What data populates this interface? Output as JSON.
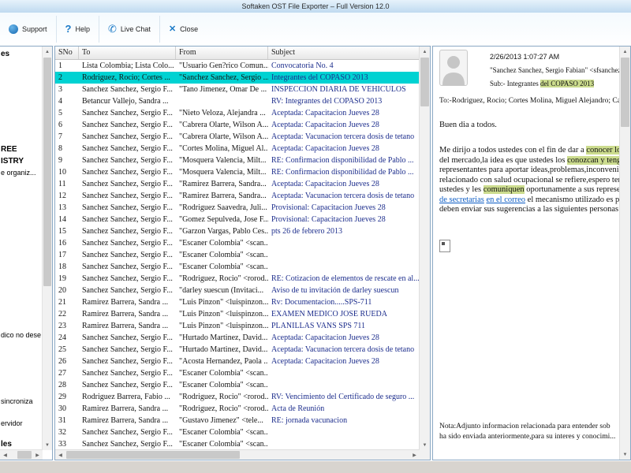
{
  "window": {
    "title": "Softaken OST File Exporter – Full Version 12.0"
  },
  "toolbar": {
    "buttons": [
      {
        "label": "Support",
        "icon": "support-icon"
      },
      {
        "label": "Help",
        "icon": "help-icon"
      },
      {
        "label": "Live Chat",
        "icon": "phone-icon"
      },
      {
        "label": "Close",
        "icon": "close-icon"
      }
    ]
  },
  "folder_tree": {
    "items": [
      {
        "label": "es",
        "bold": true
      },
      {
        "label": "REE",
        "bold": true
      },
      {
        "label": "ISTRY",
        "bold": true
      },
      {
        "label": "e organiz...",
        "bold": false
      },
      {
        "label": "dico no dese",
        "bold": false
      },
      {
        "label": "sincroniza",
        "bold": false
      },
      {
        "label": "ervidor",
        "bold": false
      },
      {
        "label": "les",
        "bold": true
      }
    ]
  },
  "mail_table": {
    "columns": [
      "SNo",
      "To",
      "From",
      "Subject"
    ],
    "selected_row": 2,
    "rows": [
      {
        "sno": 1,
        "to": "Lista Colombia; Lista Colo...",
        "from": "\"Usuario Gen?rico Comun...",
        "subject": "Convocatoria No. 4"
      },
      {
        "sno": 2,
        "to": "Rodriguez, Rocio; Cortes ...",
        "from": "\"Sanchez Sanchez, Sergio ...",
        "subject": "Integrantes del COPASO 2013"
      },
      {
        "sno": 3,
        "to": "Sanchez Sanchez, Sergio F...",
        "from": "\"Tano Jimenez, Omar De ...",
        "subject": "INSPECCION DIARIA DE VEHICULOS"
      },
      {
        "sno": 4,
        "to": "Betancur Vallejo, Sandra ...",
        "from": "",
        "subject": "RV: Integrantes del COPASO 2013"
      },
      {
        "sno": 5,
        "to": "Sanchez Sanchez, Sergio F...",
        "from": "\"Nieto Veloza, Alejandra ...",
        "subject": "Aceptada: Capacitacion Jueves 28"
      },
      {
        "sno": 6,
        "to": "Sanchez Sanchez, Sergio F...",
        "from": "\"Cabrera Olarte, Wilson A...",
        "subject": "Aceptada: Capacitacion Jueves 28"
      },
      {
        "sno": 7,
        "to": "Sanchez Sanchez, Sergio F...",
        "from": "\"Cabrera Olarte, Wilson A...",
        "subject": "Aceptada: Vacunacion tercera dosis de tetano"
      },
      {
        "sno": 8,
        "to": "Sanchez Sanchez, Sergio F...",
        "from": "\"Cortes Molina, Miguel Al...",
        "subject": "Aceptada: Capacitacion Jueves 28"
      },
      {
        "sno": 9,
        "to": "Sanchez Sanchez, Sergio F...",
        "from": "\"Mosquera Valencia, Milt...",
        "subject": "RE: Confirmacion disponibilidad de Pablo ..."
      },
      {
        "sno": 10,
        "to": "Sanchez Sanchez, Sergio F...",
        "from": "\"Mosquera Valencia, Milt...",
        "subject": "RE: Confirmacion disponibilidad de Pablo ..."
      },
      {
        "sno": 11,
        "to": "Sanchez Sanchez, Sergio F...",
        "from": "\"Ramirez Barrera, Sandra...",
        "subject": "Aceptada: Capacitacion Jueves 28"
      },
      {
        "sno": 12,
        "to": "Sanchez Sanchez, Sergio F...",
        "from": "\"Ramirez Barrera, Sandra...",
        "subject": "Aceptada: Vacunacion tercera dosis de tetano"
      },
      {
        "sno": 13,
        "to": "Sanchez Sanchez, Sergio F...",
        "from": "\"Rodriguez Saavedra, Juli...",
        "subject": "Provisional: Capacitacion Jueves 28"
      },
      {
        "sno": 14,
        "to": "Sanchez Sanchez, Sergio F...",
        "from": "\"Gomez Sepulveda, Jose F...",
        "subject": "Provisional: Capacitacion Jueves 28"
      },
      {
        "sno": 15,
        "to": "Sanchez Sanchez, Sergio F...",
        "from": "\"Garzon Vargas, Pablo Ces...",
        "subject": "pts 26 de febrero 2013"
      },
      {
        "sno": 16,
        "to": "Sanchez Sanchez, Sergio F...",
        "from": "\"Escaner Colombia\" <scan...",
        "subject": ""
      },
      {
        "sno": 17,
        "to": "Sanchez Sanchez, Sergio F...",
        "from": "\"Escaner Colombia\" <scan...",
        "subject": ""
      },
      {
        "sno": 18,
        "to": "Sanchez Sanchez, Sergio F...",
        "from": "\"Escaner Colombia\" <scan...",
        "subject": ""
      },
      {
        "sno": 19,
        "to": "Sanchez Sanchez, Sergio F...",
        "from": "\"Rodriguez, Rocio\" <rorod...",
        "subject": "RE: Cotizacion de elementos de rescate en al..."
      },
      {
        "sno": 20,
        "to": "Sanchez Sanchez, Sergio F...",
        "from": "\"darley suescun (Invitaci...",
        "subject": "Aviso de tu invitación de darley suescun"
      },
      {
        "sno": 21,
        "to": "Ramirez Barrera, Sandra ...",
        "from": "\"Luis Pinzon\" <luispinzon...",
        "subject": "Rv: Documentacion.....SPS-711"
      },
      {
        "sno": 22,
        "to": "Ramirez Barrera, Sandra ...",
        "from": "\"Luis Pinzon\" <luispinzon...",
        "subject": "EXAMEN MEDICO JOSE RUEDA"
      },
      {
        "sno": 23,
        "to": "Ramirez Barrera, Sandra ...",
        "from": "\"Luis Pinzon\" <luispinzon...",
        "subject": "PLANILLAS VANS SPS 711"
      },
      {
        "sno": 24,
        "to": "Sanchez Sanchez, Sergio F...",
        "from": "\"Hurtado Martinez, David...",
        "subject": "Aceptada: Capacitacion Jueves 28"
      },
      {
        "sno": 25,
        "to": "Sanchez Sanchez, Sergio F...",
        "from": "\"Hurtado Martinez, David...",
        "subject": "Aceptada: Vacunacion tercera dosis de tetano"
      },
      {
        "sno": 26,
        "to": "Sanchez Sanchez, Sergio F...",
        "from": "\"Acosta Hernandez, Paola ...",
        "subject": "Aceptada: Capacitacion Jueves 28"
      },
      {
        "sno": 27,
        "to": "Sanchez Sanchez, Sergio F...",
        "from": "\"Escaner Colombia\" <scan...",
        "subject": ""
      },
      {
        "sno": 28,
        "to": "Sanchez Sanchez, Sergio F...",
        "from": "\"Escaner Colombia\" <scan...",
        "subject": ""
      },
      {
        "sno": 29,
        "to": "Rodriguez Barrera, Fabio ...",
        "from": "\"Rodriguez, Rocio\" <rorod...",
        "subject": "RV: Vencimiento del Certificado de seguro ..."
      },
      {
        "sno": 30,
        "to": "Ramirez Barrera, Sandra ...",
        "from": "\"Rodriguez, Rocio\" <rorod...",
        "subject": "Acta de Reunión"
      },
      {
        "sno": 31,
        "to": "Ramirez Barrera, Sandra ...",
        "from": "\"Gustavo Jimenez\" <tele...",
        "subject": "RE: jornada vacunacion"
      },
      {
        "sno": 32,
        "to": "Sanchez Sanchez, Sergio F...",
        "from": "\"Escaner Colombia\" <scan...",
        "subject": ""
      },
      {
        "sno": 33,
        "to": "Sanchez Sanchez, Sergio F...",
        "from": "\"Escaner Colombia\" <scan...",
        "subject": ""
      }
    ]
  },
  "preview": {
    "date": "2/26/2013 1:07:27 AM",
    "from": "\"Sanchez Sanchez, Sergio Fabian\" <sfsanchez",
    "subject_prefix": "Sub:- Integrantes ",
    "subject_highlight": "del COPASO 2013",
    "to": "To:-Rodriguez, Rocio; Cortes Molina, Miguel Alejandro; Cabrera",
    "greeting": "Buen dia a todos.",
    "body_lines": [
      [
        {
          "t": "Me dirijo a todos ustedes con el fin de dar a "
        },
        {
          "t": "conocer los in",
          "s": "h"
        }
      ],
      [
        {
          "t": "del mercado,la idea es que ustedes los "
        },
        {
          "t": "conozcan y tengan",
          "s": "h"
        }
      ],
      [
        {
          "t": "representantes para aportar  ideas,problemas,inconvenie"
        }
      ],
      [
        {
          "t": "relacionado con salud ocupacional se refiere,espero tena"
        }
      ],
      [
        {
          "t": "ustedes y les "
        },
        {
          "t": "comuniquen",
          "s": "h"
        },
        {
          "t": " oportunamente a sus represent"
        }
      ],
      [
        {
          "t": "de secretarias",
          "s": "l"
        },
        {
          "t": " "
        },
        {
          "t": "en el correo",
          "s": "l"
        },
        {
          "t": " el mecanismo utilizado es por"
        }
      ],
      [
        {
          "t": "deben enviar sus sugerencias a las siguientes personas :"
        }
      ]
    ],
    "nota_lines": [
      "Nota:Adjunto informacion relacionada para entender sob",
      "ha sido enviada anteriormente,para su interes y conocimi..."
    ]
  },
  "colors": {
    "selected_row": "#00d2d2",
    "highlight": "#ccdc8e",
    "link": "#0a5bc4",
    "accent_blue": "#1b7ac7",
    "subject_text": "#1c2d8c",
    "titlebar": "#c9e0f3"
  }
}
